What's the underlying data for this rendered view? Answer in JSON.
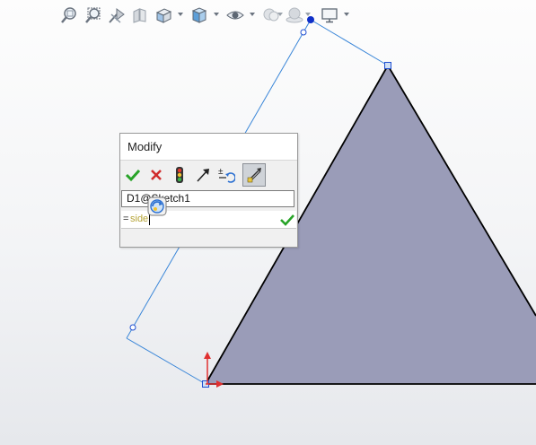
{
  "toolbar": {
    "icons": [
      "zoom-to-fit-icon",
      "zoom-to-area-icon",
      "previous-view-icon",
      "section-view-icon",
      "view-orientation-icon",
      "display-style-icon",
      "hide-show-items-icon",
      "edit-appearance-icon",
      "apply-scene-icon",
      "view-settings-icon"
    ]
  },
  "dialog": {
    "title": "Modify",
    "buttons": [
      "accept-check-icon",
      "cancel-x-icon",
      "regenerate-icon",
      "reverse-dimension-icon",
      "increment-icon",
      "mark-for-drawing-icon"
    ],
    "dimension_name": "D1@Sketch1",
    "value_prefix": "=",
    "value_text": "side"
  },
  "colors": {
    "triangle_fill": "#9a9cb8",
    "triangle_stroke": "#000000",
    "construction_line": "#3a86d8",
    "sketch_point": "#1f4fd1",
    "origin_red": "#e03030",
    "check_green": "#27a327",
    "cancel_red": "#d02a2a"
  }
}
